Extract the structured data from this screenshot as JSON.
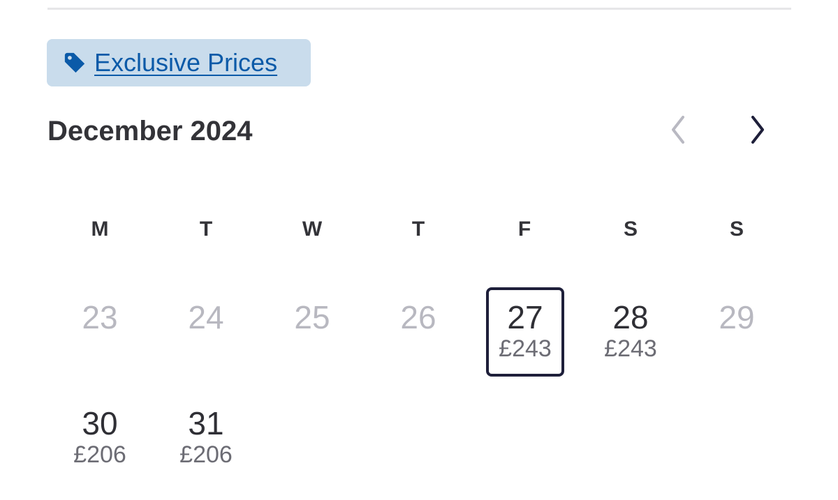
{
  "promo": {
    "label": "Exclusive Prices",
    "icon": "tag-icon",
    "bg_color": "#c9dcec",
    "text_color": "#0b5aa8"
  },
  "calendar": {
    "month_title": "December 2024",
    "prev_icon": "chevron-left-icon",
    "next_icon": "chevron-right-icon",
    "weekdays": [
      "M",
      "T",
      "W",
      "T",
      "F",
      "S",
      "S"
    ],
    "selected_border_color": "#1e1f3a",
    "weeks": [
      [
        {
          "day": "23",
          "price": "",
          "state": "disabled"
        },
        {
          "day": "24",
          "price": "",
          "state": "disabled"
        },
        {
          "day": "25",
          "price": "",
          "state": "disabled"
        },
        {
          "day": "26",
          "price": "",
          "state": "disabled"
        },
        {
          "day": "27",
          "price": "£243",
          "state": "selected"
        },
        {
          "day": "28",
          "price": "£243",
          "state": "available"
        },
        {
          "day": "29",
          "price": "",
          "state": "disabled"
        }
      ],
      [
        {
          "day": "30",
          "price": "£206",
          "state": "available"
        },
        {
          "day": "31",
          "price": "£206",
          "state": "available"
        }
      ]
    ]
  }
}
